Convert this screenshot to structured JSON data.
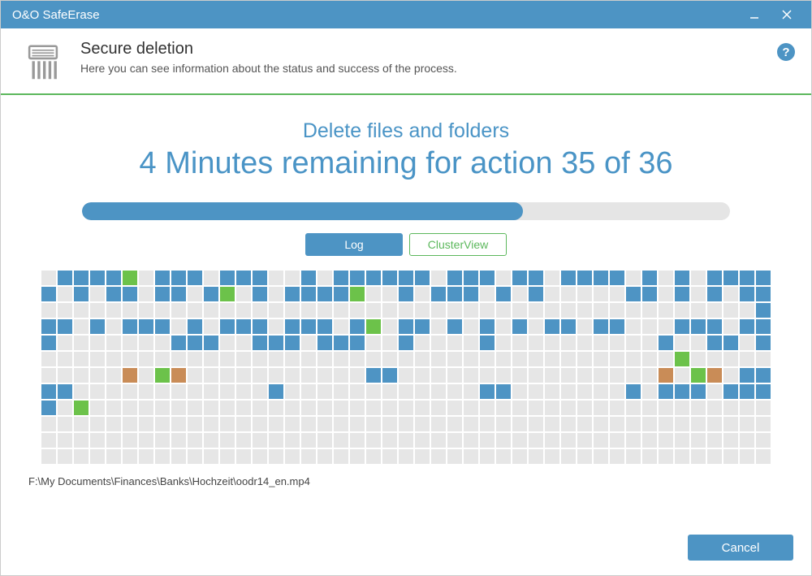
{
  "window": {
    "title": "O&O SafeErase"
  },
  "header": {
    "title": "Secure deletion",
    "subtitle": "Here you can see information about the status and success of the process."
  },
  "main": {
    "task": "Delete files and folders",
    "remaining": "4 Minutes remaining for action 35 of 36",
    "progress_percent": 68,
    "tabs": {
      "log": "Log",
      "cluster": "ClusterView",
      "active": "cluster"
    },
    "current_file": "F:\\My Documents\\Finances\\Banks\\Hochzeit\\oodr14_en.mp4"
  },
  "footer": {
    "cancel": "Cancel"
  },
  "help_tooltip": "?",
  "cluster_grid": {
    "cols": 45,
    "rows": 12,
    "legend": {
      "b": "cell-blue",
      "g": "cell-green",
      "o": "cell-orange",
      ".": "cell-gray"
    },
    "rows_data": [
      ".bbbbg.bbb.bbb..b.bbbbbb.bbb.bb.bbbb.b.b.bbbb",
      "b.b.bb.bb.bg.b.bbbbg..b.bbb.b.b.....bb.b.b.bb",
      "............................................b",
      "bb.b.bbb.b.bbb.bbb.bg.bb.b.b.b.bb.bb...bbb.bb",
      "b.......bbb..bbb.bbb..b....b..........b..bb.b",
      ".......................................g.....",
      ".....o.go...........bb................o.go.bb",
      "bb............b............bb.......b.bbb.bbb",
      "b.g..........................................",
      ".............................................",
      ".............................................",
      "............................................."
    ]
  }
}
